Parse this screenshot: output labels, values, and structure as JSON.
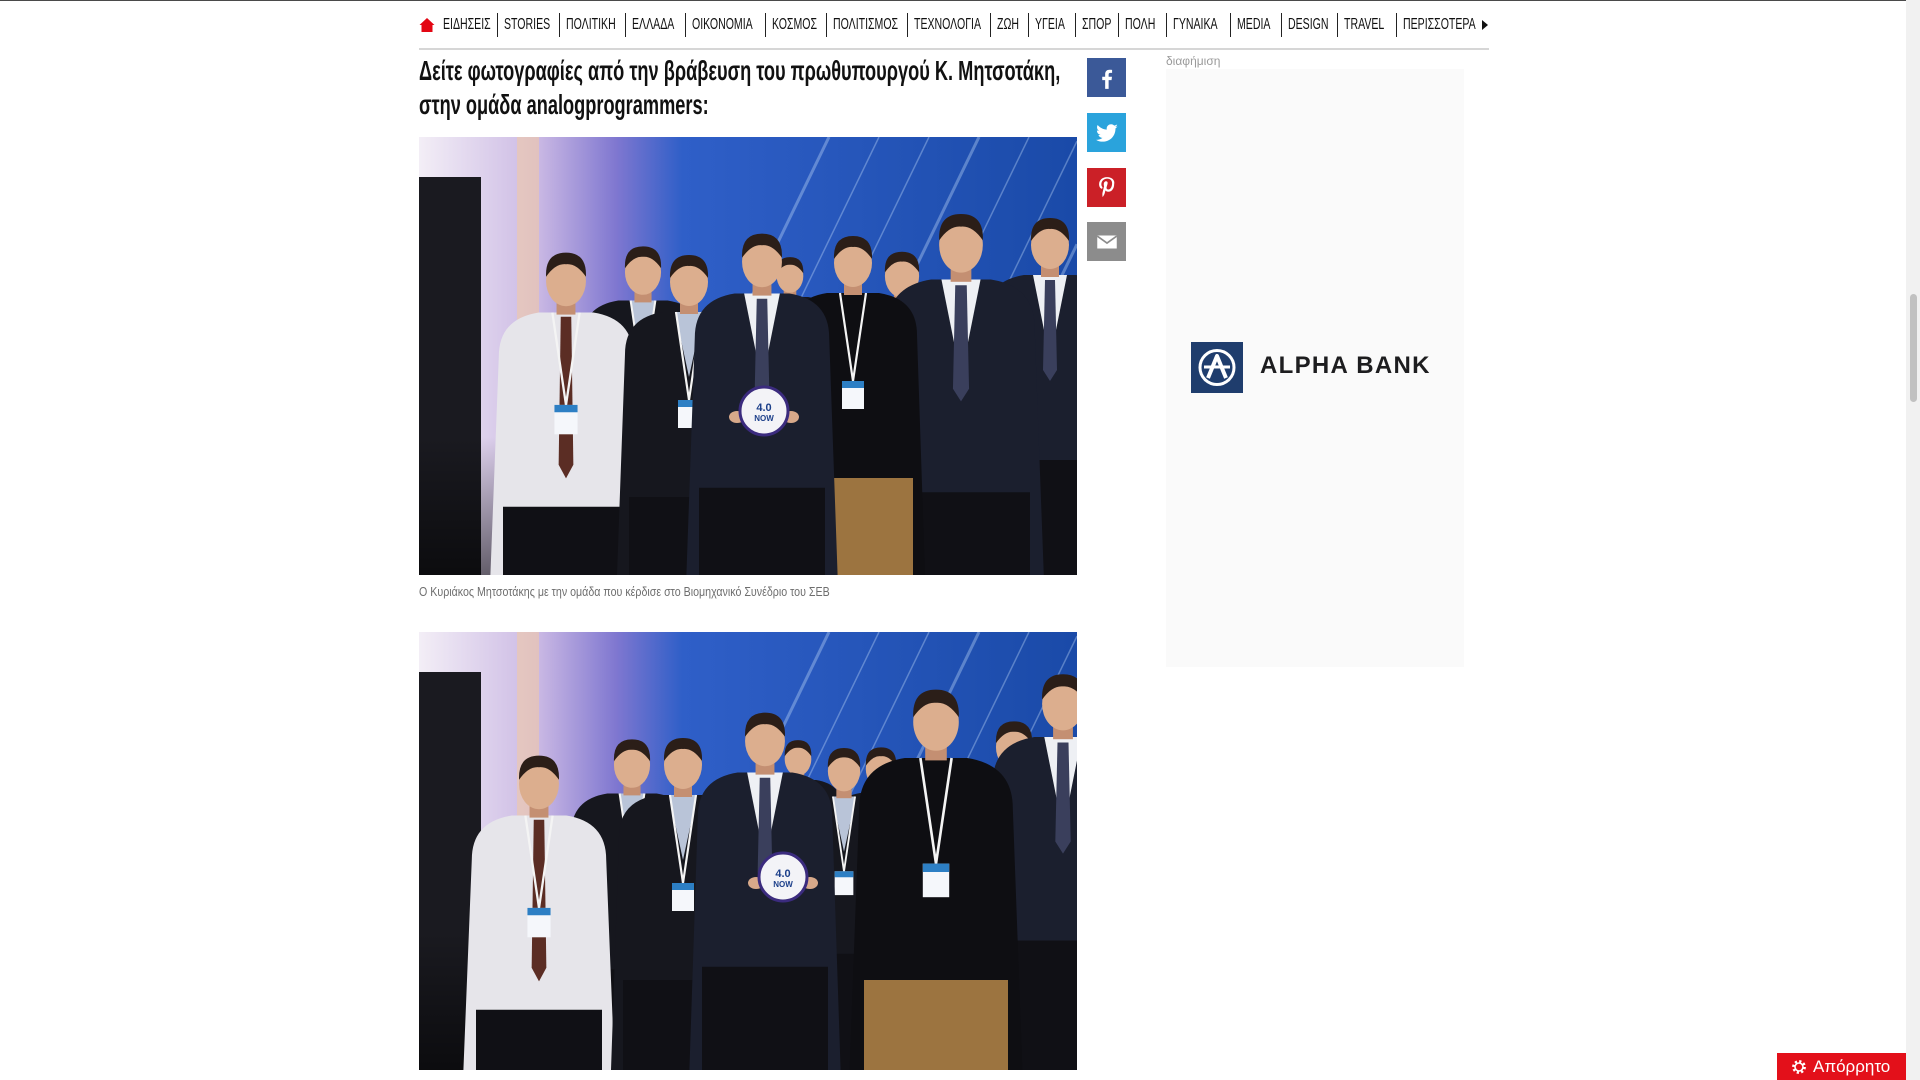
{
  "theme": {
    "accent": "#e30613",
    "text": "#111111",
    "caption": "#6e6e6e"
  },
  "nav": {
    "home_icon": "home-icon",
    "items": [
      "ΕΙΔΗΣΕΙΣ",
      "STORIES",
      "ΠΟΛΙΤΙΚΗ",
      "ΕΛΛΑΔΑ",
      "ΟΙΚΟΝΟΜΙΑ",
      "ΚΟΣΜΟΣ",
      "ΠΟΛΙΤΙΣΜΟΣ",
      "ΤΕΧΝΟΛΟΓΙΑ",
      "ΖΩΗ",
      "ΥΓΕΙΑ",
      "ΣΠΟΡ",
      "ΠΟΛΗ",
      "ΓΥΝΑΙΚΑ",
      "MEDIA",
      "DESIGN",
      "TRAVEL"
    ],
    "more_label": "ΠΕΡΙΣΣΟΤΕΡΑ",
    "more_icon": "caret-right-icon"
  },
  "article": {
    "heading": "Δείτε φωτογραφίες από την βράβευση του πρωθυπουργού Κ. Μητσοτάκη, στην ομάδα analogprogrammers:",
    "photos": [
      {
        "caption": "Ο Κυριάκος Μητσοτάκης με την ομάδα που κέρδισε στο Βιομηχανικό Συνέδριο του ΣΕΒ",
        "plaque": [
          "4.0",
          "NOW"
        ]
      },
      {
        "plaque": [
          "4.0",
          "NOW"
        ]
      }
    ]
  },
  "share": [
    {
      "icon": "facebook-icon",
      "color": "#3b5998"
    },
    {
      "icon": "twitter-icon",
      "color": "#2aa3dc"
    },
    {
      "icon": "pinterest-icon",
      "color": "#cb2027"
    },
    {
      "icon": "email-icon",
      "color": "#8c8c8c"
    }
  ],
  "sidebar": {
    "ad_label": "διαφήμιση",
    "ad_brand": "ALPHA BANK",
    "ad_brand_color": "#1f3d6d"
  },
  "privacy": {
    "label": "Απόρρητο",
    "icon": "gear-icon",
    "color": "#e3101a"
  }
}
